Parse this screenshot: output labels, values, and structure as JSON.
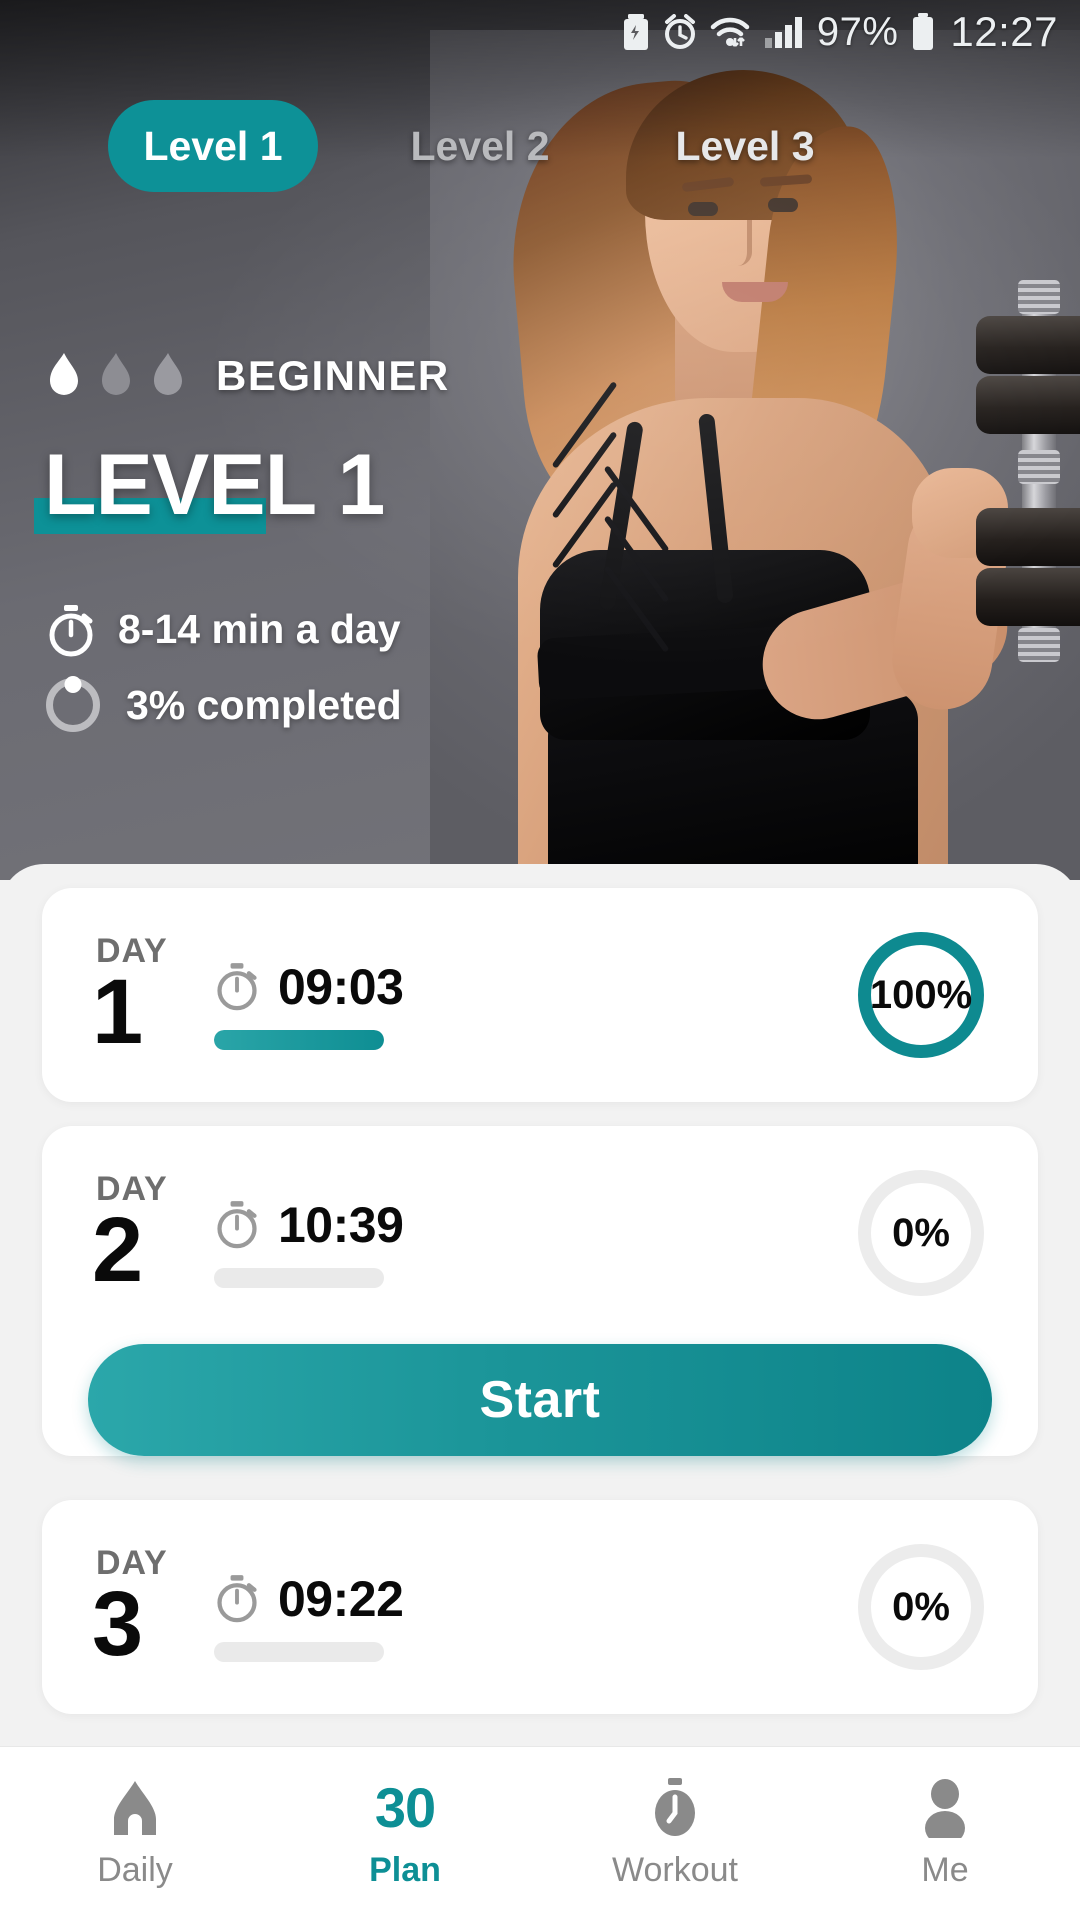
{
  "status_bar": {
    "icons": [
      "battery-saver-icon",
      "alarm-icon",
      "wifi-icon",
      "signal-icon"
    ],
    "battery_percent": "97%",
    "time": "12:27"
  },
  "theme": {
    "accent": "#0d9197",
    "accent_dark": "#0e8a90",
    "sheet_bg": "#f2f2f2",
    "card_bg": "#ffffff",
    "text_dark": "#0a0a0a",
    "text_muted": "#6e6e6e",
    "empty_ring": "#ececec"
  },
  "tabs": [
    {
      "label": "Level 1",
      "active": true
    },
    {
      "label": "Level 2",
      "active": false
    },
    {
      "label": "Level 3",
      "active": false
    }
  ],
  "hero": {
    "difficulty_label": "BEGINNER",
    "flames_total": 3,
    "flames_filled": 1,
    "title": "LEVEL 1",
    "duration": "8-14 min a day",
    "completion": "3% completed"
  },
  "days": [
    {
      "day_label": "DAY",
      "day_number": "1",
      "duration": "09:03",
      "progress_percent": 100,
      "percent_label": "100%",
      "has_start": false
    },
    {
      "day_label": "DAY",
      "day_number": "2",
      "duration": "10:39",
      "progress_percent": 0,
      "percent_label": "0%",
      "has_start": true,
      "start_label": "Start"
    },
    {
      "day_label": "DAY",
      "day_number": "3",
      "duration": "09:22",
      "progress_percent": 0,
      "percent_label": "0%",
      "has_start": false
    }
  ],
  "bottom_nav": [
    {
      "label": "Daily",
      "icon": "home-icon",
      "active": false
    },
    {
      "label": "Plan",
      "icon": "30-badge-icon",
      "badge": "30",
      "active": true
    },
    {
      "label": "Workout",
      "icon": "stopwatch-icon",
      "active": false
    },
    {
      "label": "Me",
      "icon": "person-icon",
      "active": false
    }
  ]
}
